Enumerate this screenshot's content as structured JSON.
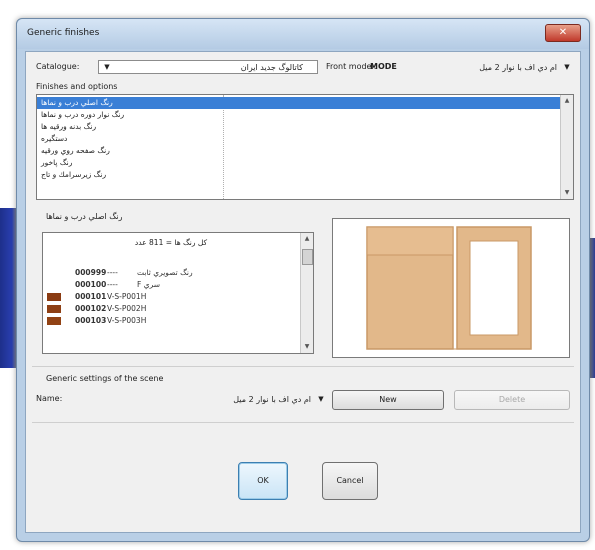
{
  "window": {
    "title": "Generic finishes",
    "close_label": "✕"
  },
  "catalogue": {
    "label": "Catalogue:",
    "value": "کاتالوگ جدید ایران"
  },
  "front_model": {
    "label": "Front model:",
    "code": "MODE",
    "value": "ام دي اف با نوار 2 ميل"
  },
  "finishes_options": {
    "label": "Finishes and options",
    "items": [
      "رنگ اصلي درب و نماها",
      "رنگ نوار دوره درب و نماها",
      "رنگ بدنه ورقيه ها",
      "دستگيره",
      "رنگ صفحه روي ورقيه",
      "رنگ پاخور",
      "رنگ زيرسرامك و تاج"
    ],
    "selected_index": 0
  },
  "finish_panel": {
    "label": "رنگ اصلي درب و نماها",
    "header": "كل رنگ ها = 811 عدد",
    "rows": [
      {
        "color": "",
        "code": "000999",
        "desc": "----",
        "name": "رنگ تصويري ثابت"
      },
      {
        "color": "",
        "code": "000100",
        "desc": "----",
        "name": "سري F"
      },
      {
        "color": "#8a3b12",
        "code": "000101",
        "desc": "V-S-P001H",
        "name": ""
      },
      {
        "color": "#8e3f14",
        "code": "000102",
        "desc": "V-S-P002H",
        "name": ""
      },
      {
        "color": "#914214",
        "code": "000103",
        "desc": "V-S-P003H",
        "name": ""
      }
    ]
  },
  "scene": {
    "label": "Generic settings of the scene",
    "name_label": "Name:",
    "name_value": "ام دي اف با نوار 2 ميل",
    "new_label": "New",
    "delete_label": "Delete"
  },
  "buttons": {
    "ok": "OK",
    "cancel": "Cancel"
  },
  "colors": {
    "selection": "#3a7fd6",
    "cabinet_wood": "#e2b88a",
    "cabinet_edge": "#c99866"
  },
  "icons": {
    "dropdown": "chevron-down-icon",
    "scroll_up": "scroll-up-icon",
    "scroll_down": "scroll-down-icon"
  }
}
